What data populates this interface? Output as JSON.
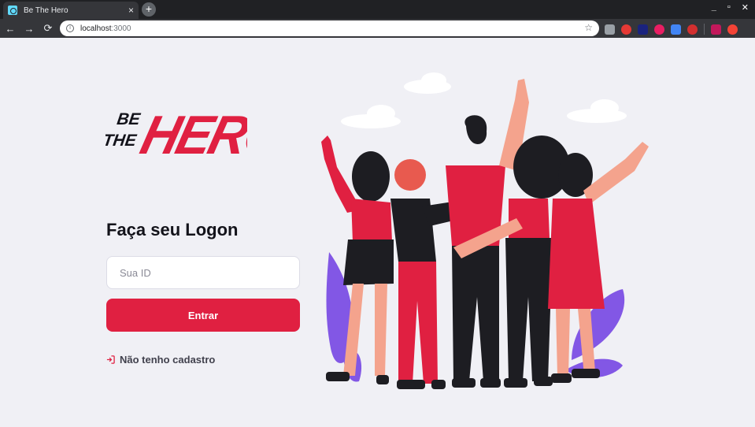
{
  "browser": {
    "tab_title": "Be The Hero",
    "tab_close": "×",
    "new_tab": "+",
    "window_controls": [
      "_",
      "▫",
      "✕"
    ],
    "nav": {
      "back": "←",
      "forward": "→",
      "reload": "⟳"
    },
    "url_host": "localhost",
    "url_port": ":3000",
    "extensions": [
      "#9aa0a6",
      "#e53935",
      "#1a237e",
      "#e91e63",
      "#4285f4",
      "#d32f2f",
      "#c2185b",
      "#f44336"
    ]
  },
  "logo": {
    "line1": "BE",
    "line2": "THE",
    "word": "HERO",
    "color_dark": "#13131a",
    "color_accent": "#e02041"
  },
  "form": {
    "title": "Faça seu Logon",
    "id_placeholder": "Sua ID",
    "id_value": "",
    "submit_label": "Entrar",
    "register_link": "Não tenho cadastro"
  },
  "colors": {
    "background": "#f0f0f5",
    "accent": "#e02041",
    "text": "#13131a"
  }
}
